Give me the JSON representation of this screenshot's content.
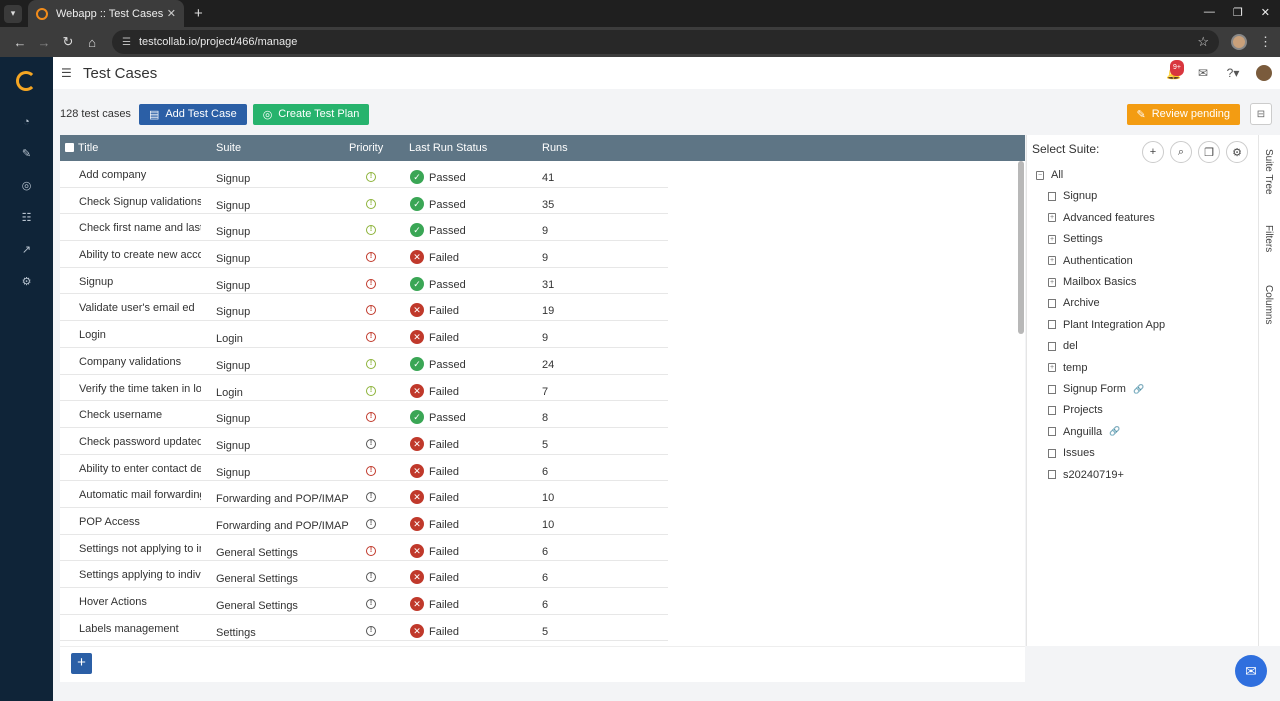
{
  "browser": {
    "tab_title": "Webapp :: Test Cases",
    "url": "testcollab.io/project/466/manage",
    "new_tab": "+",
    "tab_close": "✕"
  },
  "header": {
    "title": "Test Cases",
    "notification_badge": "9+"
  },
  "toolbar": {
    "count": "128 test cases",
    "add_test_case": "Add Test Case",
    "create_test_plan": "Create Test Plan",
    "review_pending": "Review pending"
  },
  "table": {
    "columns": [
      "Title",
      "Suite",
      "Priority",
      "Last Run Status",
      "Runs"
    ],
    "rows": [
      {
        "title": "Add company",
        "suite": "Signup",
        "priority": "medium",
        "status": "Passed",
        "runs": "41"
      },
      {
        "title": "Check Signup validations",
        "suite": "Signup",
        "priority": "medium",
        "status": "Passed",
        "runs": "35"
      },
      {
        "title": "Check first name and last na",
        "suite": "Signup",
        "priority": "medium",
        "status": "Passed",
        "runs": "9"
      },
      {
        "title": "Ability to create new accoun",
        "suite": "Signup",
        "priority": "high",
        "status": "Failed",
        "runs": "9"
      },
      {
        "title": "Signup",
        "suite": "Signup",
        "priority": "high",
        "status": "Passed",
        "runs": "31"
      },
      {
        "title": "Validate user's email ed",
        "suite": "Signup",
        "priority": "high",
        "status": "Failed",
        "runs": "19"
      },
      {
        "title": "Login",
        "suite": "Login",
        "priority": "high",
        "status": "Failed",
        "runs": "9"
      },
      {
        "title": "Company validations",
        "suite": "Signup",
        "priority": "medium",
        "status": "Passed",
        "runs": "24"
      },
      {
        "title": "Verify the time taken in load",
        "suite": "Login",
        "priority": "medium",
        "status": "Failed",
        "runs": "7"
      },
      {
        "title": "Check username",
        "suite": "Signup",
        "priority": "high",
        "status": "Passed",
        "runs": "8"
      },
      {
        "title": "Check password updated",
        "suite": "Signup",
        "priority": "low",
        "status": "Failed",
        "runs": "5"
      },
      {
        "title": "Ability to enter contact deta",
        "suite": "Signup",
        "priority": "high",
        "status": "Failed",
        "runs": "6"
      },
      {
        "title": "Automatic mail forwarding",
        "suite": "Forwarding and POP/IMAP",
        "priority": "low",
        "status": "Failed",
        "runs": "10"
      },
      {
        "title": "POP Access",
        "suite": "Forwarding and POP/IMAP",
        "priority": "low",
        "status": "Failed",
        "runs": "10"
      },
      {
        "title": "Settings not applying to indi",
        "suite": "General Settings",
        "priority": "high",
        "status": "Failed",
        "runs": "6"
      },
      {
        "title": "Settings applying to individu",
        "suite": "General Settings",
        "priority": "low",
        "status": "Failed",
        "runs": "6"
      },
      {
        "title": "Hover Actions",
        "suite": "General Settings",
        "priority": "low",
        "status": "Failed",
        "runs": "6"
      },
      {
        "title": "Labels management",
        "suite": "Settings",
        "priority": "low",
        "status": "Failed",
        "runs": "5"
      }
    ]
  },
  "suite_panel": {
    "title": "Select Suite:",
    "items": [
      {
        "label": "All",
        "kind": "collapse",
        "indent": 0,
        "link": false
      },
      {
        "label": "Signup",
        "kind": "file",
        "indent": 1,
        "link": false
      },
      {
        "label": "Advanced features",
        "kind": "expand",
        "indent": 1,
        "link": false
      },
      {
        "label": "Settings",
        "kind": "expand",
        "indent": 1,
        "link": false
      },
      {
        "label": "Authentication",
        "kind": "expand",
        "indent": 1,
        "link": false
      },
      {
        "label": "Mailbox Basics",
        "kind": "expand",
        "indent": 1,
        "link": false
      },
      {
        "label": "Archive",
        "kind": "file",
        "indent": 1,
        "link": false
      },
      {
        "label": "Plant Integration App",
        "kind": "file",
        "indent": 1,
        "link": false
      },
      {
        "label": "del",
        "kind": "file",
        "indent": 1,
        "link": false
      },
      {
        "label": "temp",
        "kind": "expand",
        "indent": 1,
        "link": false
      },
      {
        "label": "Signup Form",
        "kind": "file",
        "indent": 1,
        "link": true
      },
      {
        "label": "Projects",
        "kind": "file",
        "indent": 1,
        "link": false
      },
      {
        "label": "Anguilla",
        "kind": "file",
        "indent": 1,
        "link": true
      },
      {
        "label": "Issues",
        "kind": "file",
        "indent": 1,
        "link": false
      },
      {
        "label": "s20240719+",
        "kind": "file",
        "indent": 1,
        "link": false
      }
    ]
  },
  "side_tabs": [
    "Suite Tree",
    "Filters",
    "Columns"
  ],
  "colors": {
    "passed": "#3aa655",
    "failed": "#c0392b",
    "priority_medium": "#8db33a",
    "priority_high": "#c0392b",
    "priority_low": "#555555"
  }
}
